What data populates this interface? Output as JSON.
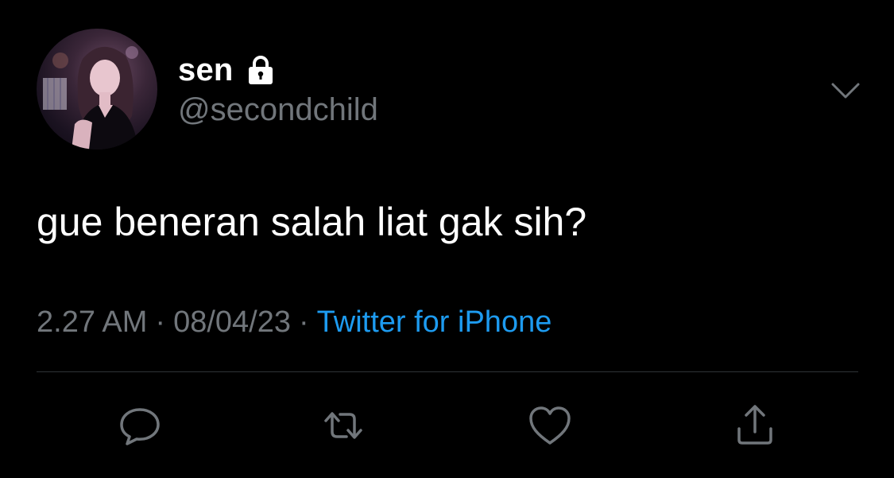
{
  "user": {
    "display_name": "sen",
    "handle": "@secondchild",
    "protected_icon": "lock-icon",
    "avatar_icon": "profile-photo"
  },
  "tweet": {
    "text": "gue beneran salah liat gak sih?",
    "time": "2.27 AM",
    "date": "08/04/23",
    "separator": "·",
    "source": "Twitter for iPhone"
  },
  "menu": {
    "icon": "chevron-down-icon"
  },
  "actions": [
    {
      "icon": "reply-icon"
    },
    {
      "icon": "retweet-icon"
    },
    {
      "icon": "like-icon"
    },
    {
      "icon": "share-icon"
    }
  ],
  "colors": {
    "background": "#000000",
    "primary_text": "#ffffff",
    "secondary_text": "#71767b",
    "link": "#1d9bf0",
    "divider": "#2f3336"
  }
}
